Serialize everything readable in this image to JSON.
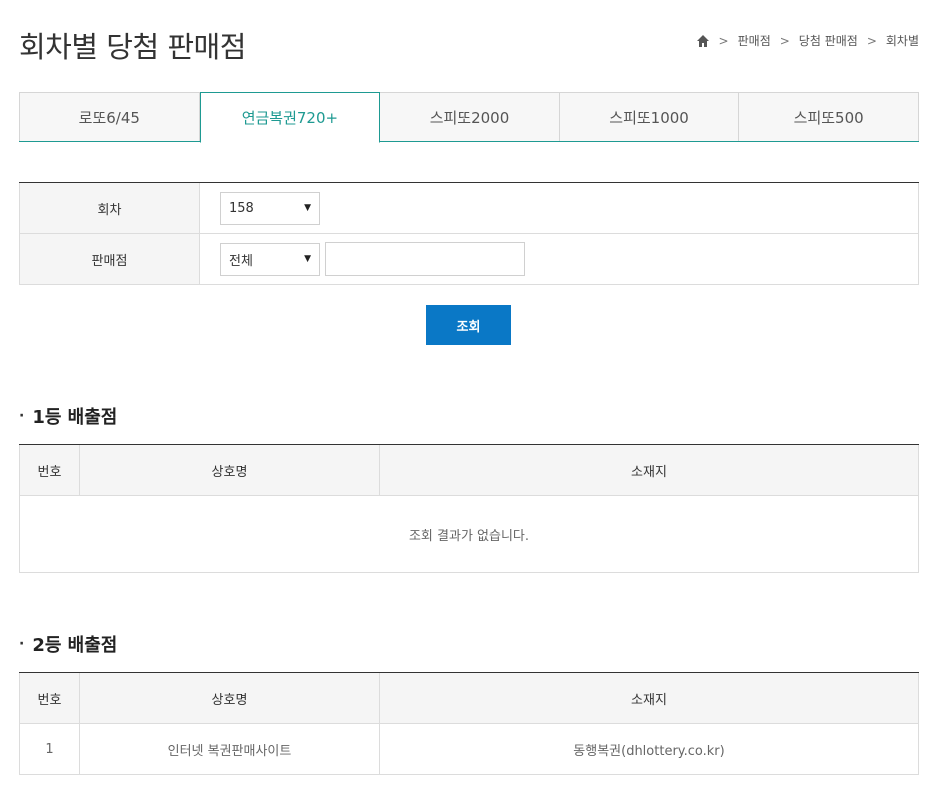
{
  "page": {
    "title": "회차별 당첨 판매점"
  },
  "breadcrumb": {
    "items": [
      "판매점",
      "당첨 판매점",
      "회차별"
    ]
  },
  "tabs": [
    {
      "label": "로또6/45",
      "active": false
    },
    {
      "label": "연금복권720+",
      "active": true
    },
    {
      "label": "스피또2000",
      "active": false
    },
    {
      "label": "스피또1000",
      "active": false
    },
    {
      "label": "스피또500",
      "active": false
    }
  ],
  "search": {
    "round_label": "회차",
    "round_value": "158",
    "store_label": "판매점",
    "store_filter_value": "전체",
    "store_input_value": "",
    "button_label": "조회"
  },
  "first_prize": {
    "title": "1등 배출점",
    "columns": [
      "번호",
      "상호명",
      "소재지"
    ],
    "empty_message": "조회 결과가 없습니다."
  },
  "second_prize": {
    "title": "2등 배출점",
    "columns": [
      "번호",
      "상호명",
      "소재지"
    ],
    "rows": [
      {
        "no": "1",
        "name": "인터넷 복권판매사이트",
        "address": "동행복권(dhlottery.co.kr)"
      }
    ]
  },
  "colors": {
    "accent": "#1e9a92",
    "button": "#0a78c6"
  }
}
